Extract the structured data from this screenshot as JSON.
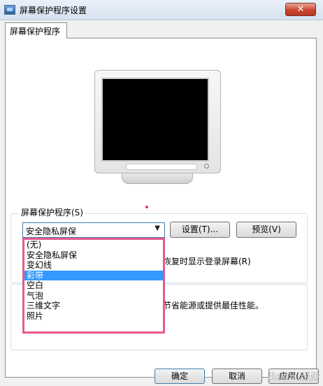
{
  "window": {
    "title": "屏幕保护程序设置",
    "close_symbol": "✕"
  },
  "tabs": [
    {
      "label": "屏幕保护程序"
    }
  ],
  "screensaver": {
    "group_label": "屏幕保护程序(S)",
    "selected": "安全隐私屏保",
    "dropdown_arrow": "▼",
    "settings_button": "设置(T)...",
    "preview_button": "预览(V)",
    "resume_text": "恢复时显示登录屏幕(R)",
    "options": [
      "(无)",
      "安全隐私屏保",
      "变幻线",
      "彩带",
      "空白",
      "气泡",
      "三维文字",
      "照片"
    ],
    "highlighted_option": "彩带"
  },
  "power": {
    "text": "节省能源或提供最佳性能。"
  },
  "buttons": {
    "ok": "确定",
    "cancel": "取消",
    "apply": "应用(A)"
  },
  "watermark": "Baidu 经验",
  "colors": {
    "highlight": "#3399ff",
    "annotation": "#e55a8e"
  }
}
